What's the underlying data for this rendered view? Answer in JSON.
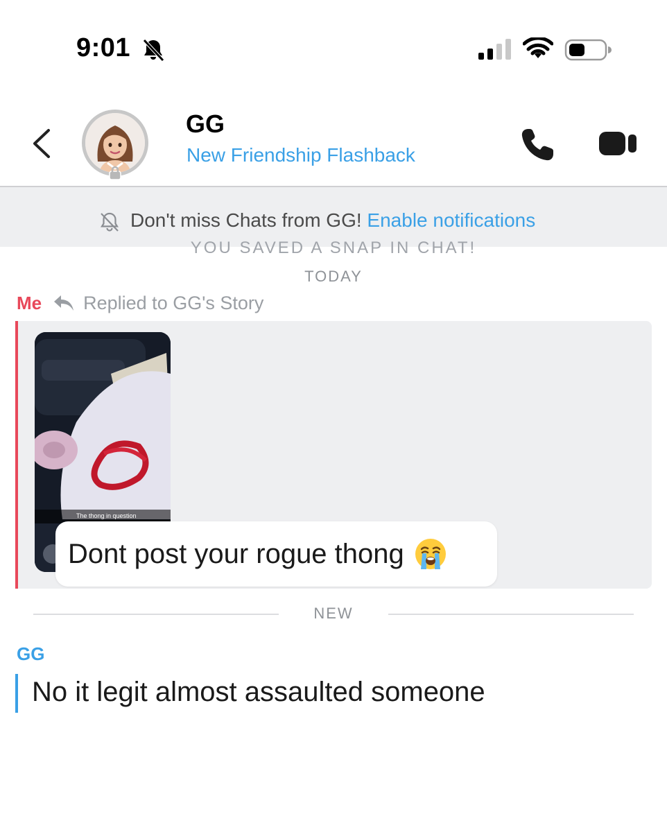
{
  "status_bar": {
    "time": "9:01",
    "icons": [
      "bell-off-icon",
      "cellular-signal-icon",
      "wifi-icon",
      "battery-icon"
    ]
  },
  "header": {
    "contact_name": "GG",
    "subtitle": "New Friendship Flashback",
    "icons": [
      "back-chevron-icon",
      "bitmoji-avatar",
      "lock-icon",
      "phone-icon",
      "video-camera-icon"
    ]
  },
  "notification_banner": {
    "text": "Don't miss Chats from GG!",
    "link": "Enable notifications",
    "icon": "bell-off-icon"
  },
  "chat": {
    "saved_note": "YOU SAVED A SNAP IN CHAT!",
    "date_separator": "TODAY",
    "reply_sender": "Me",
    "reply_context": "Replied to GG's Story",
    "story_caption": "The thong in question",
    "my_message": "Dont post your rogue thong",
    "my_message_emoji": "loudly-crying-face-emoji",
    "new_separator": "NEW",
    "other_sender": "GG",
    "other_message": "No it legit almost assaulted someone"
  },
  "colors": {
    "me_accent": "#e8485a",
    "friend_accent": "#3aa0e6",
    "link": "#3aa0e6",
    "banner_bg": "#eeeff1"
  }
}
